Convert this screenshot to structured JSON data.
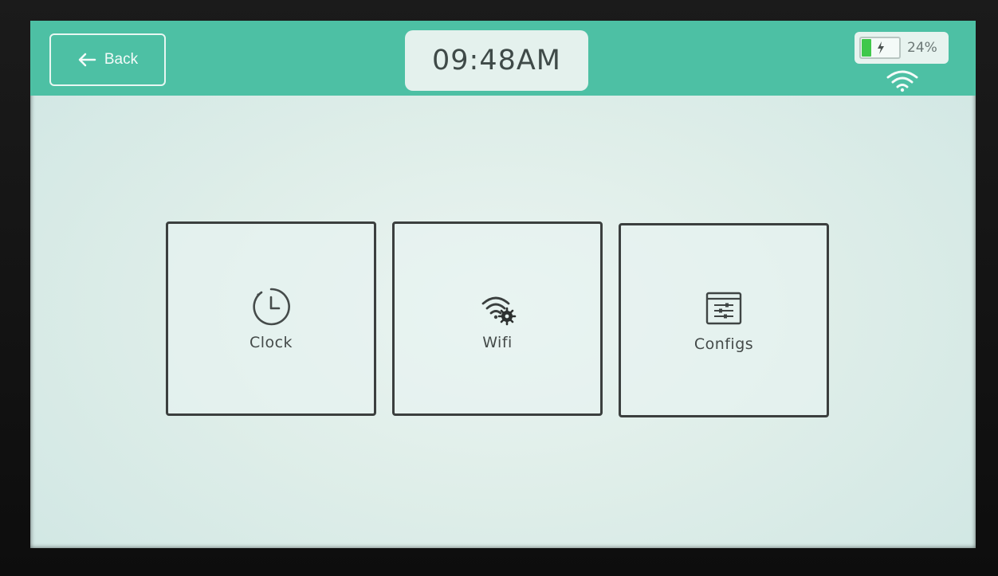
{
  "header": {
    "back_label": "Back",
    "time": "09:48AM",
    "battery": {
      "percent_label": "24%",
      "level": 0.24,
      "fill_color": "#3fc84a",
      "charging": true
    },
    "wifi_status_icon": "wifi-icon",
    "bar_color": "#4dc0a4"
  },
  "tiles": [
    {
      "label": "Clock",
      "icon": "clock-icon"
    },
    {
      "label": "Wifi",
      "icon": "wifi-settings-icon"
    },
    {
      "label": "Configs",
      "icon": "configs-window-icon"
    }
  ]
}
